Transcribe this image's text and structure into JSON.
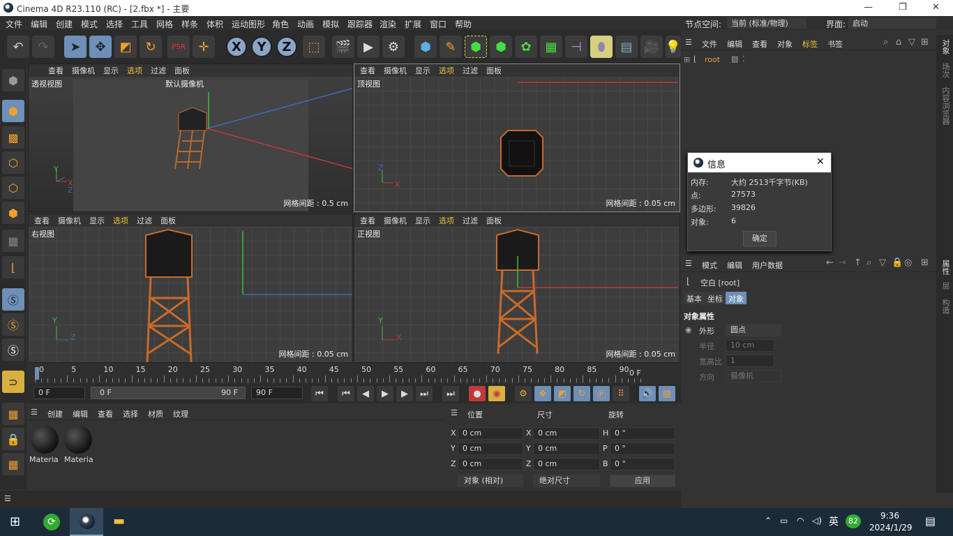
{
  "window": {
    "title": "Cinema 4D R23.110 (RC) - [2.fbx *] - 主要"
  },
  "menu": [
    "文件",
    "编辑",
    "创建",
    "模式",
    "选择",
    "工具",
    "网格",
    "样条",
    "体积",
    "运动图形",
    "角色",
    "动画",
    "模拟",
    "跟踪器",
    "渲染",
    "扩展",
    "窗口",
    "帮助"
  ],
  "node_space": {
    "label": "节点空间:",
    "value": "当前 (标准/物理)"
  },
  "layout": {
    "label": "界面:",
    "value": "启动"
  },
  "viewport_menu": [
    "查看",
    "摄像机",
    "显示",
    "选项",
    "过滤",
    "面板"
  ],
  "viewports": [
    {
      "name": "透视视图",
      "grid": "网格间距 : 0.5 cm",
      "camera": "默认摄像机"
    },
    {
      "name": "顶视图",
      "grid": "网格间距 : 0.05 cm"
    },
    {
      "name": "右视图",
      "grid": "网格间距 : 0.05 cm"
    },
    {
      "name": "正视图",
      "grid": "网格间距 : 0.05 cm"
    }
  ],
  "axes": {
    "x": "X",
    "y": "Y",
    "z": "Z"
  },
  "timeline": {
    "ticks": [
      "0",
      "5",
      "10",
      "15",
      "20",
      "25",
      "30",
      "35",
      "40",
      "45",
      "50",
      "55",
      "60",
      "65",
      "70",
      "75",
      "80",
      "85",
      "90"
    ],
    "end_label": "0 F"
  },
  "transport": {
    "start": "0 F",
    "range_start": "0 F",
    "range_end": "90 F",
    "end": "90 F"
  },
  "material_menu": [
    "创建",
    "编辑",
    "查看",
    "选择",
    "材质",
    "纹理"
  ],
  "materials": [
    "Materia",
    "Materia"
  ],
  "coords": {
    "headers": [
      "位置",
      "尺寸",
      "旋转"
    ],
    "rows": [
      {
        "a": "X",
        "pos": "0 cm",
        "b": "X",
        "size": "0 cm",
        "c": "H",
        "rot": "0 °"
      },
      {
        "a": "Y",
        "pos": "0 cm",
        "b": "Y",
        "size": "0 cm",
        "c": "P",
        "rot": "0 °"
      },
      {
        "a": "Z",
        "pos": "0 cm",
        "b": "Z",
        "size": "0 cm",
        "c": "B",
        "rot": "0 °"
      }
    ],
    "mode": "对象 (相对)",
    "size_mode": "绝对尺寸",
    "apply": "应用"
  },
  "object_manager": {
    "menu": [
      "文件",
      "编辑",
      "查看",
      "对象",
      "标签",
      "书签"
    ],
    "root": "root"
  },
  "info_dialog": {
    "title": "信息",
    "rows": [
      {
        "k": "内存:",
        "v": "大约 2513千字节(KB)"
      },
      {
        "k": "点:",
        "v": "27573"
      },
      {
        "k": "多边形:",
        "v": "39826"
      },
      {
        "k": "对象:",
        "v": "6"
      }
    ],
    "ok": "确定"
  },
  "attributes": {
    "menu": [
      "模式",
      "编辑",
      "用户数据"
    ],
    "object": "空白 [root]",
    "tabs": [
      "基本",
      "坐标",
      "对象"
    ],
    "section": "对象属性",
    "props": [
      {
        "k": "外形",
        "v": "圆点"
      },
      {
        "k": "半径",
        "v": "10 cm"
      },
      {
        "k": "宽高比",
        "v": "1"
      },
      {
        "k": "方向",
        "v": "摄像机"
      }
    ]
  },
  "right_strip": [
    "对象",
    "场次",
    "内容浏览器",
    "属性",
    "层",
    "构造"
  ],
  "taskbar": {
    "time": "9:36",
    "date": "2024/1/29",
    "ime": "英",
    "badge": "82"
  }
}
